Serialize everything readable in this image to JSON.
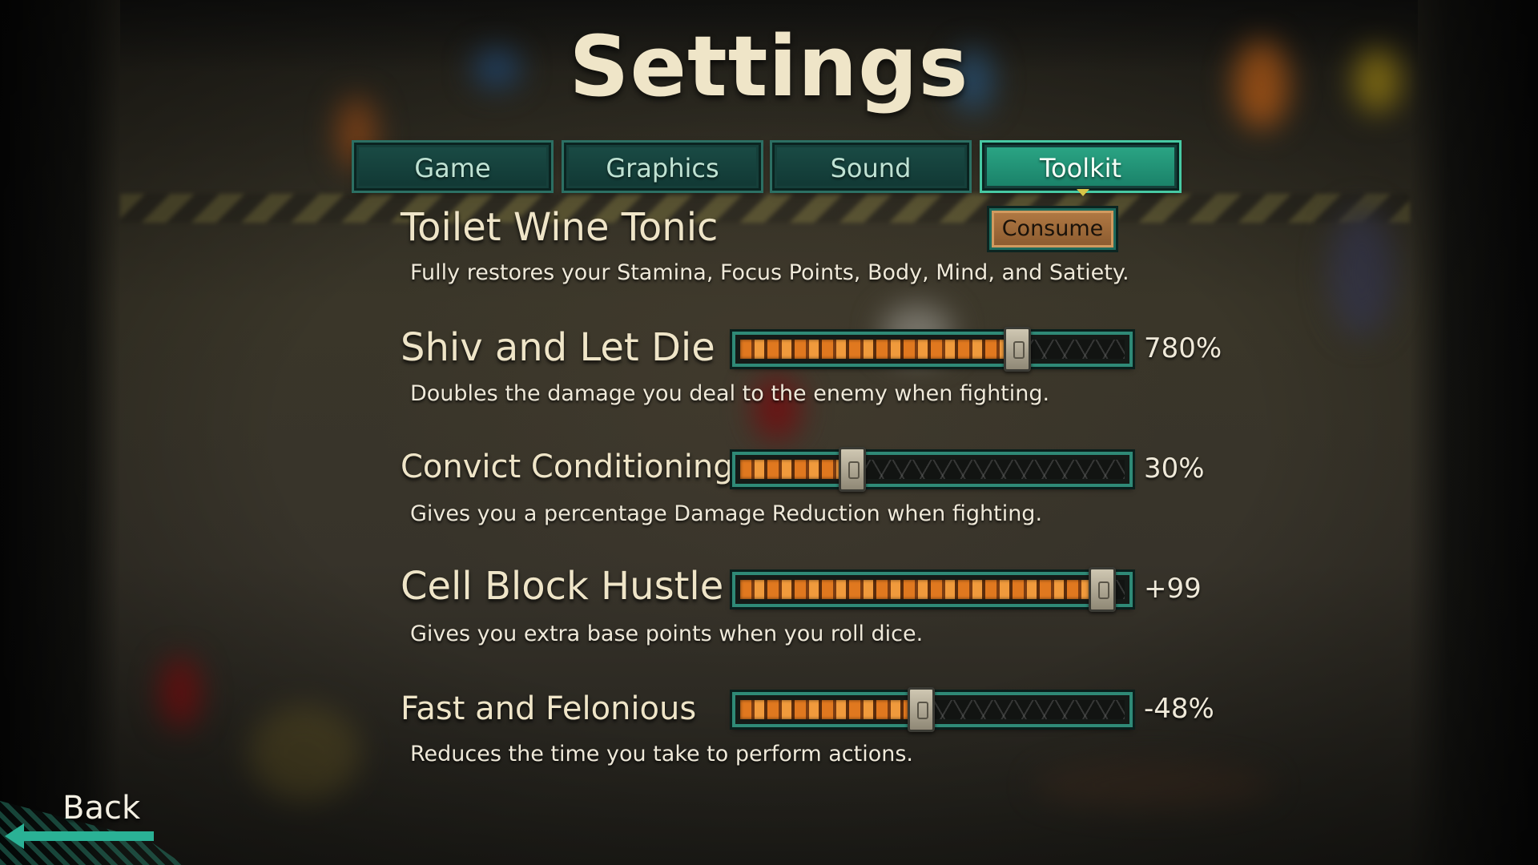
{
  "header": {
    "title": "Settings"
  },
  "tabs": [
    {
      "label": "Game",
      "active": false
    },
    {
      "label": "Graphics",
      "active": false
    },
    {
      "label": "Sound",
      "active": false
    },
    {
      "label": "Toolkit",
      "active": true
    }
  ],
  "consumable": {
    "title": "Toilet Wine Tonic",
    "button_label": "Consume",
    "description": "Fully restores your Stamina, Focus Points, Body, Mind, and Satiety."
  },
  "sliders": [
    {
      "title": "Shiv and Let Die",
      "value_text": "780%",
      "fill_fraction": 0.73,
      "description": "Doubles the damage you deal to the enemy when fighting.",
      "icon": "speaker-icon"
    },
    {
      "title": "Convict Conditioning",
      "value_text": "30%",
      "fill_fraction": 0.3,
      "description": "Gives you a percentage Damage Reduction when fighting.",
      "icon": "speaker-icon"
    },
    {
      "title": "Cell Block Hustle",
      "value_text": "+99",
      "fill_fraction": 0.95,
      "description": "Gives you extra base points when you roll dice.",
      "icon": "speaker-icon"
    },
    {
      "title": "Fast and Felonious",
      "value_text": "-48%",
      "fill_fraction": 0.48,
      "description": "Reduces the time you take to perform actions.",
      "icon": "speaker-icon"
    }
  ],
  "footer": {
    "back_label": "Back"
  },
  "colors": {
    "accent": "#2ba685",
    "slider_fill": "#e0781f",
    "title_text": "#efe5c8"
  }
}
